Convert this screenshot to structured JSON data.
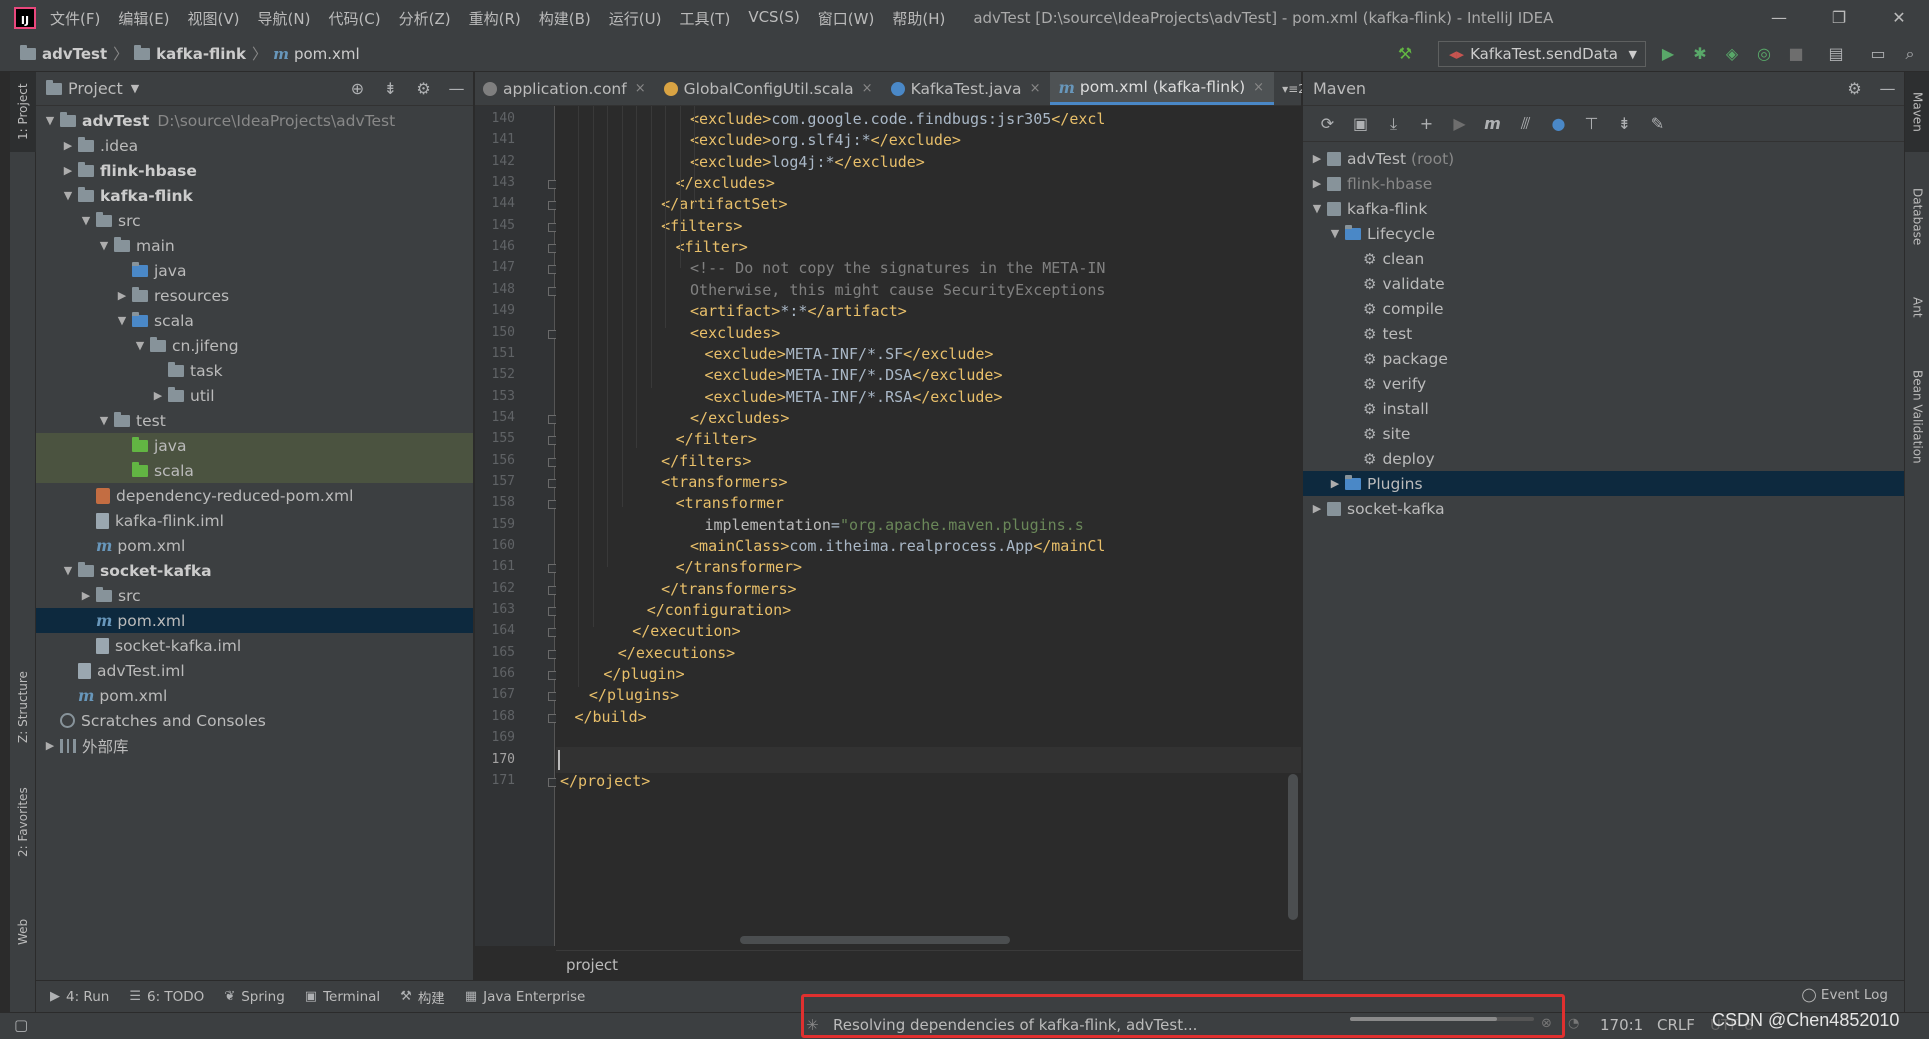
{
  "titlebar": {
    "logo": "IJ",
    "menu": [
      "文件(F)",
      "编辑(E)",
      "视图(V)",
      "导航(N)",
      "代码(C)",
      "分析(Z)",
      "重构(R)",
      "构建(B)",
      "运行(U)",
      "工具(T)",
      "VCS(S)",
      "窗口(W)",
      "帮助(H)"
    ],
    "title": "advTest [D:\\source\\IdeaProjects\\advTest] - pom.xml (kafka-flink) - IntelliJ IDEA",
    "controls": [
      "—",
      "❐",
      "✕"
    ]
  },
  "navbar": {
    "crumbs": [
      "advTest",
      "kafka-flink",
      "pom.xml"
    ],
    "run_config": "KafkaTest.sendData"
  },
  "left_stripe": [
    "1: Project",
    "Z: Structure",
    "2: Favorites",
    "Web"
  ],
  "project_panel": {
    "title": "Project",
    "tree": [
      {
        "depth": 0,
        "arrow": "▼",
        "icon": "folder",
        "label": "advTest",
        "bold": true,
        "extra": "D:\\source\\IdeaProjects\\advTest"
      },
      {
        "depth": 1,
        "arrow": "▶",
        "icon": "folder",
        "label": ".idea"
      },
      {
        "depth": 1,
        "arrow": "▶",
        "icon": "folder",
        "label": "flink-hbase",
        "bold": true
      },
      {
        "depth": 1,
        "arrow": "▼",
        "icon": "folder",
        "label": "kafka-flink",
        "bold": true
      },
      {
        "depth": 2,
        "arrow": "▼",
        "icon": "folder",
        "label": "src"
      },
      {
        "depth": 3,
        "arrow": "▼",
        "icon": "folder",
        "label": "main"
      },
      {
        "depth": 4,
        "arrow": "",
        "icon": "folder-blue",
        "label": "java"
      },
      {
        "depth": 4,
        "arrow": "▶",
        "icon": "folder",
        "label": "resources"
      },
      {
        "depth": 4,
        "arrow": "▼",
        "icon": "folder-blue",
        "label": "scala"
      },
      {
        "depth": 5,
        "arrow": "▼",
        "icon": "folder",
        "label": "cn.jifeng"
      },
      {
        "depth": 6,
        "arrow": "",
        "icon": "folder",
        "label": "task"
      },
      {
        "depth": 6,
        "arrow": "▶",
        "icon": "folder",
        "label": "util"
      },
      {
        "depth": 3,
        "arrow": "▼",
        "icon": "folder",
        "label": "test"
      },
      {
        "depth": 4,
        "arrow": "",
        "icon": "folder-green",
        "label": "java",
        "highlight": true
      },
      {
        "depth": 4,
        "arrow": "",
        "icon": "folder-green",
        "label": "scala",
        "highlight": true
      },
      {
        "depth": 2,
        "arrow": "",
        "icon": "xml",
        "label": "dependency-reduced-pom.xml"
      },
      {
        "depth": 2,
        "arrow": "",
        "icon": "file",
        "label": "kafka-flink.iml"
      },
      {
        "depth": 2,
        "arrow": "",
        "icon": "maven",
        "label": "pom.xml"
      },
      {
        "depth": 1,
        "arrow": "▼",
        "icon": "folder",
        "label": "socket-kafka",
        "bold": true
      },
      {
        "depth": 2,
        "arrow": "▶",
        "icon": "folder",
        "label": "src"
      },
      {
        "depth": 2,
        "arrow": "",
        "icon": "maven",
        "label": "pom.xml",
        "selected": true
      },
      {
        "depth": 2,
        "arrow": "",
        "icon": "file",
        "label": "socket-kafka.iml"
      },
      {
        "depth": 1,
        "arrow": "",
        "icon": "file",
        "label": "advTest.iml"
      },
      {
        "depth": 1,
        "arrow": "",
        "icon": "maven",
        "label": "pom.xml"
      },
      {
        "depth": 0,
        "arrow": "",
        "icon": "scratch",
        "label": "Scratches and Consoles"
      },
      {
        "depth": 0,
        "arrow": "▶",
        "icon": "lib",
        "label": "外部库"
      }
    ]
  },
  "editor": {
    "tabs": [
      {
        "label": "application.conf",
        "color": "#7f7f7f"
      },
      {
        "label": "GlobalConfigUtil.scala",
        "color": "#d9a343"
      },
      {
        "label": "KafkaTest.java",
        "color": "#4a88c7"
      },
      {
        "label": "pom.xml (kafka-flink)",
        "color": "",
        "active": true
      }
    ],
    "tab_overflow": "▾≡2",
    "caret_line": 170,
    "lines": [
      {
        "n": 140,
        "indent": 18,
        "parts": [
          [
            "tag",
            "<exclude>"
          ],
          [
            "txt",
            "com.google.code.findbugs:jsr305"
          ],
          [
            "tag",
            "</excl"
          ]
        ]
      },
      {
        "n": 141,
        "indent": 18,
        "parts": [
          [
            "tag",
            "<exclude>"
          ],
          [
            "txt",
            "org.slf4j:*"
          ],
          [
            "tag",
            "</exclude>"
          ]
        ]
      },
      {
        "n": 142,
        "indent": 18,
        "parts": [
          [
            "tag",
            "<exclude>"
          ],
          [
            "txt",
            "log4j:*"
          ],
          [
            "tag",
            "</exclude>"
          ]
        ]
      },
      {
        "n": 143,
        "indent": 16,
        "parts": [
          [
            "tag",
            "</excludes>"
          ]
        ]
      },
      {
        "n": 144,
        "indent": 14,
        "parts": [
          [
            "tag",
            "</artifactSet>"
          ]
        ]
      },
      {
        "n": 145,
        "indent": 14,
        "parts": [
          [
            "tag",
            "<filters>"
          ]
        ]
      },
      {
        "n": 146,
        "indent": 16,
        "parts": [
          [
            "tag",
            "<filter>"
          ]
        ]
      },
      {
        "n": 147,
        "indent": 18,
        "parts": [
          [
            "cmt",
            "<!-- Do not copy the signatures in the META-IN"
          ]
        ]
      },
      {
        "n": 148,
        "indent": 18,
        "parts": [
          [
            "cmt",
            "Otherwise, this might cause SecurityExceptions"
          ]
        ]
      },
      {
        "n": 149,
        "indent": 18,
        "parts": [
          [
            "tag",
            "<artifact>"
          ],
          [
            "txt",
            "*:*"
          ],
          [
            "tag",
            "</artifact>"
          ]
        ]
      },
      {
        "n": 150,
        "indent": 18,
        "parts": [
          [
            "tag",
            "<excludes>"
          ]
        ]
      },
      {
        "n": 151,
        "indent": 20,
        "parts": [
          [
            "tag",
            "<exclude>"
          ],
          [
            "txt",
            "META-INF/*.SF"
          ],
          [
            "tag",
            "</exclude>"
          ]
        ]
      },
      {
        "n": 152,
        "indent": 20,
        "parts": [
          [
            "tag",
            "<exclude>"
          ],
          [
            "txt",
            "META-INF/*.DSA"
          ],
          [
            "tag",
            "</exclude>"
          ]
        ]
      },
      {
        "n": 153,
        "indent": 20,
        "parts": [
          [
            "tag",
            "<exclude>"
          ],
          [
            "txt",
            "META-INF/*.RSA"
          ],
          [
            "tag",
            "</exclude>"
          ]
        ]
      },
      {
        "n": 154,
        "indent": 18,
        "parts": [
          [
            "tag",
            "</excludes>"
          ]
        ]
      },
      {
        "n": 155,
        "indent": 16,
        "parts": [
          [
            "tag",
            "</filter>"
          ]
        ]
      },
      {
        "n": 156,
        "indent": 14,
        "parts": [
          [
            "tag",
            "</filters>"
          ]
        ]
      },
      {
        "n": 157,
        "indent": 14,
        "parts": [
          [
            "tag",
            "<transformers>"
          ]
        ]
      },
      {
        "n": 158,
        "indent": 16,
        "parts": [
          [
            "tag",
            "<transformer"
          ]
        ]
      },
      {
        "n": 159,
        "indent": 20,
        "parts": [
          [
            "attr",
            "implementation"
          ],
          [
            "txt",
            "="
          ],
          [
            "str",
            "\"org.apache.maven.plugins.s"
          ]
        ]
      },
      {
        "n": 160,
        "indent": 18,
        "parts": [
          [
            "tag",
            "<mainClass>"
          ],
          [
            "txt",
            "com.itheima.realprocess.App"
          ],
          [
            "tag",
            "</mainCl"
          ]
        ]
      },
      {
        "n": 161,
        "indent": 16,
        "parts": [
          [
            "tag",
            "</transformer>"
          ]
        ]
      },
      {
        "n": 162,
        "indent": 14,
        "parts": [
          [
            "tag",
            "</transformers>"
          ]
        ]
      },
      {
        "n": 163,
        "indent": 12,
        "parts": [
          [
            "tag",
            "</configuration>"
          ]
        ]
      },
      {
        "n": 164,
        "indent": 10,
        "parts": [
          [
            "tag",
            "</execution>"
          ]
        ]
      },
      {
        "n": 165,
        "indent": 8,
        "parts": [
          [
            "tag",
            "</executions>"
          ]
        ]
      },
      {
        "n": 166,
        "indent": 6,
        "parts": [
          [
            "tag",
            "</plugin>"
          ]
        ]
      },
      {
        "n": 167,
        "indent": 4,
        "parts": [
          [
            "tag",
            "</plugins>"
          ]
        ]
      },
      {
        "n": 168,
        "indent": 2,
        "parts": [
          [
            "tag",
            "</build>"
          ]
        ]
      },
      {
        "n": 169,
        "indent": 0,
        "parts": []
      },
      {
        "n": 170,
        "indent": 0,
        "parts": []
      },
      {
        "n": 171,
        "indent": 0,
        "parts": [
          [
            "tag",
            "</project>"
          ]
        ]
      }
    ],
    "breadcrumb": "project"
  },
  "maven_panel": {
    "title": "Maven",
    "tree": [
      {
        "depth": 0,
        "arrow": "▶",
        "icon": "proj",
        "label": "advTest",
        "suffix": "(root)"
      },
      {
        "depth": 0,
        "arrow": "▶",
        "icon": "proj",
        "label": "flink-hbase",
        "dim": true
      },
      {
        "depth": 0,
        "arrow": "▼",
        "icon": "proj",
        "label": "kafka-flink"
      },
      {
        "depth": 1,
        "arrow": "▼",
        "icon": "folder",
        "label": "Lifecycle"
      },
      {
        "depth": 2,
        "arrow": "",
        "icon": "gear",
        "label": "clean"
      },
      {
        "depth": 2,
        "arrow": "",
        "icon": "gear",
        "label": "validate"
      },
      {
        "depth": 2,
        "arrow": "",
        "icon": "gear",
        "label": "compile"
      },
      {
        "depth": 2,
        "arrow": "",
        "icon": "gear",
        "label": "test"
      },
      {
        "depth": 2,
        "arrow": "",
        "icon": "gear",
        "label": "package"
      },
      {
        "depth": 2,
        "arrow": "",
        "icon": "gear",
        "label": "verify"
      },
      {
        "depth": 2,
        "arrow": "",
        "icon": "gear",
        "label": "install"
      },
      {
        "depth": 2,
        "arrow": "",
        "icon": "gear",
        "label": "site"
      },
      {
        "depth": 2,
        "arrow": "",
        "icon": "gear",
        "label": "deploy"
      },
      {
        "depth": 1,
        "arrow": "▶",
        "icon": "folder",
        "label": "Plugins",
        "selected": true
      },
      {
        "depth": 0,
        "arrow": "▶",
        "icon": "proj",
        "label": "socket-kafka"
      }
    ]
  },
  "right_stripe": [
    "Maven",
    "Database",
    "Ant",
    "Bean Validation"
  ],
  "bottom_tabs": [
    {
      "icon": "▶",
      "label": "4: Run"
    },
    {
      "icon": "☰",
      "label": "6: TODO"
    },
    {
      "icon": "❦",
      "label": "Spring"
    },
    {
      "icon": "▣",
      "label": "Terminal"
    },
    {
      "icon": "⚒",
      "label": "构建"
    },
    {
      "icon": "▦",
      "label": "Java Enterprise"
    }
  ],
  "event_log": "Event Log",
  "status": {
    "message": "Resolving dependencies of kafka-flink, advTest...",
    "progress": 0.8,
    "position": "170:1",
    "line_sep": "CRLF",
    "encoding": "UTF-8",
    "watermark": "CSDN @Chen4852010"
  },
  "colors": {
    "highlight_box": "#e0302f",
    "accent": "#4a88c7"
  }
}
